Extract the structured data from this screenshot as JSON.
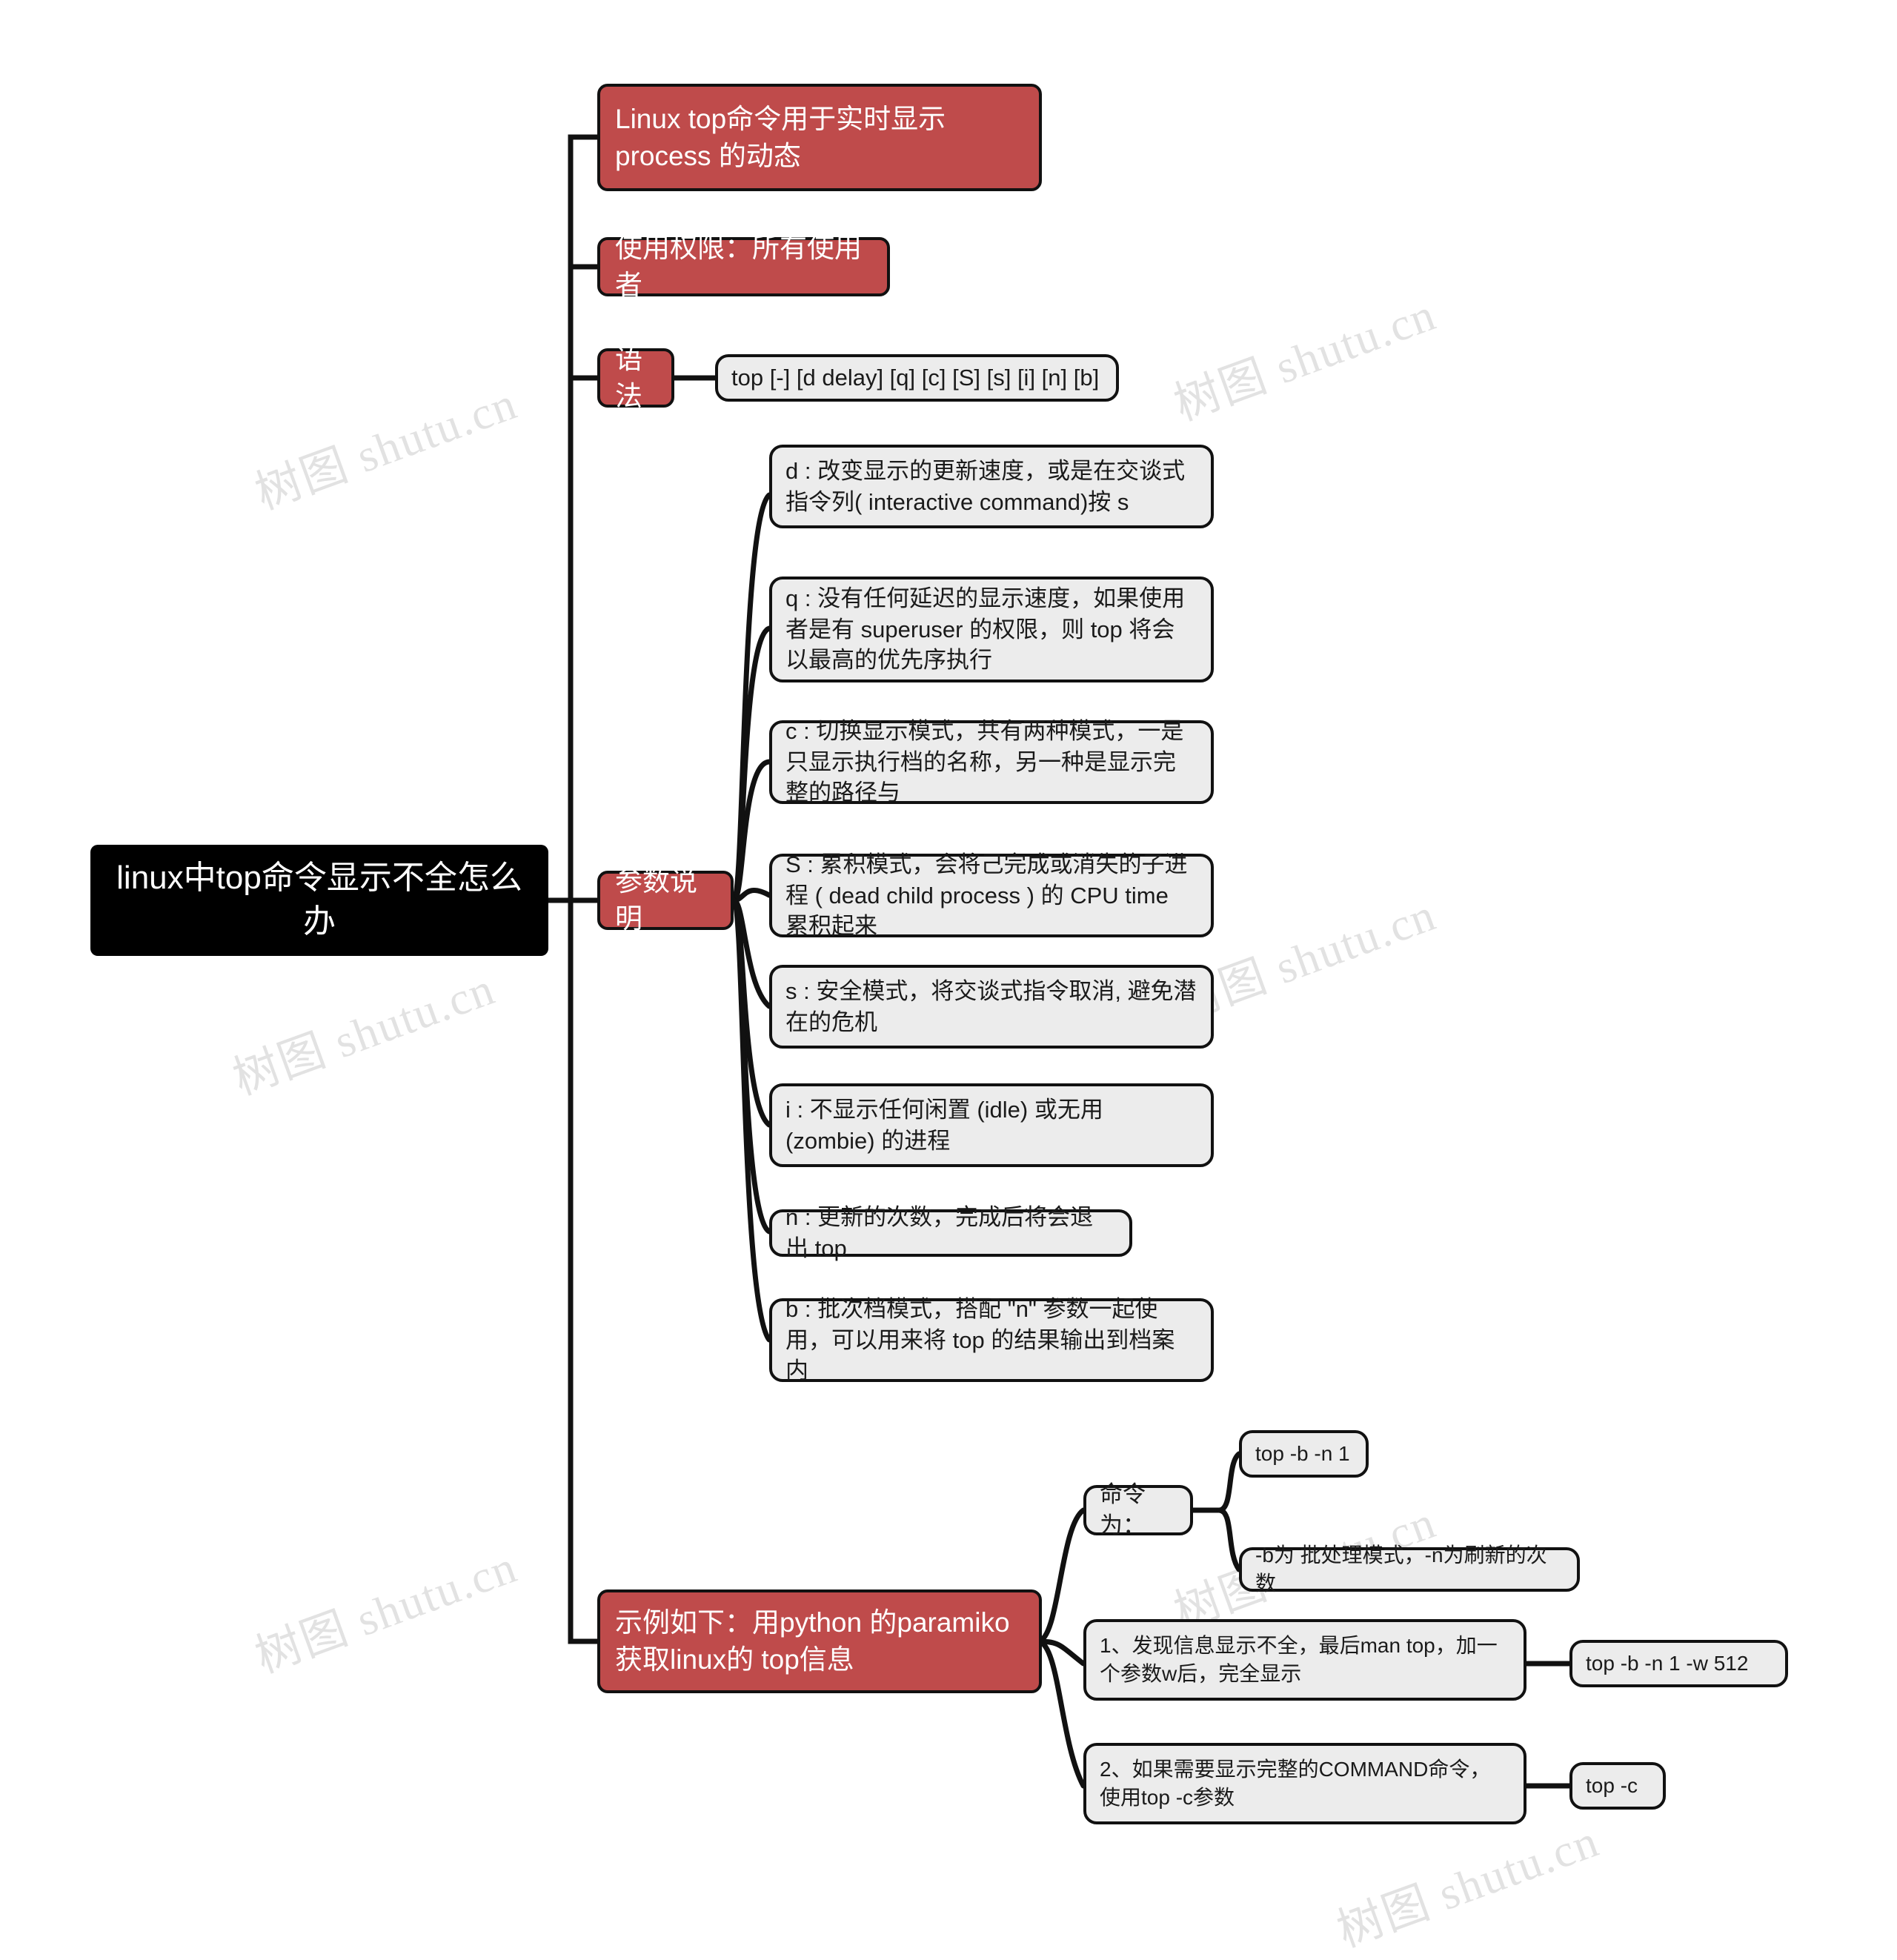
{
  "watermark": {
    "text": "树图 shutu.cn"
  },
  "mindmap": {
    "root": {
      "label": "linux中top命令显示不全怎么办"
    },
    "branches": [
      {
        "label": "Linux top命令用于实时显示 process 的动态"
      },
      {
        "label": "使用权限：所有使用者"
      },
      {
        "label": "语法",
        "children": [
          {
            "label": "top [-] [d delay] [q] [c] [S] [s] [i] [n] [b]"
          }
        ]
      },
      {
        "label": "参数说明",
        "children": [
          {
            "label": "d : 改变显示的更新速度，或是在交谈式指令列( interactive command)按 s"
          },
          {
            "label": "q : 没有任何延迟的显示速度，如果使用者是有 superuser 的权限，则 top 将会以最高的优先序执行"
          },
          {
            "label": "c : 切换显示模式，共有两种模式，一是只显示执行档的名称，另一种是显示完整的路径与"
          },
          {
            "label": "S : 累积模式，会将己完成或消失的子进程 ( dead child process ) 的 CPU time 累积起来"
          },
          {
            "label": "s : 安全模式，将交谈式指令取消, 避免潜在的危机"
          },
          {
            "label": "i : 不显示任何闲置 (idle) 或无用 (zombie) 的进程"
          },
          {
            "label": "n : 更新的次数，完成后将会退出 top"
          },
          {
            "label": "b : 批次档模式，搭配 \"n\" 参数一起使用，可以用来将 top 的结果输出到档案内"
          }
        ]
      },
      {
        "label": "示例如下：用python 的paramiko 获取linux的 top信息",
        "children": [
          {
            "label": "命令为：",
            "children": [
              {
                "label": "top -b -n 1"
              },
              {
                "label": "-b为 批处理模式，-n为刷新的次数"
              }
            ]
          },
          {
            "label": "1、发现信息显示不全，最后man top，加一个参数w后，完全显示",
            "children": [
              {
                "label": "top -b -n 1 -w 512"
              }
            ]
          },
          {
            "label": "2、如果需要显示完整的COMMAND命令，使用top -c参数",
            "children": [
              {
                "label": "top -c"
              }
            ]
          }
        ]
      }
    ]
  },
  "colors": {
    "root_background": "#000000",
    "branch_background": "#bf4b4b",
    "leaf_background": "#ececec",
    "stroke": "#111111",
    "watermark": "#e2e2e2"
  }
}
